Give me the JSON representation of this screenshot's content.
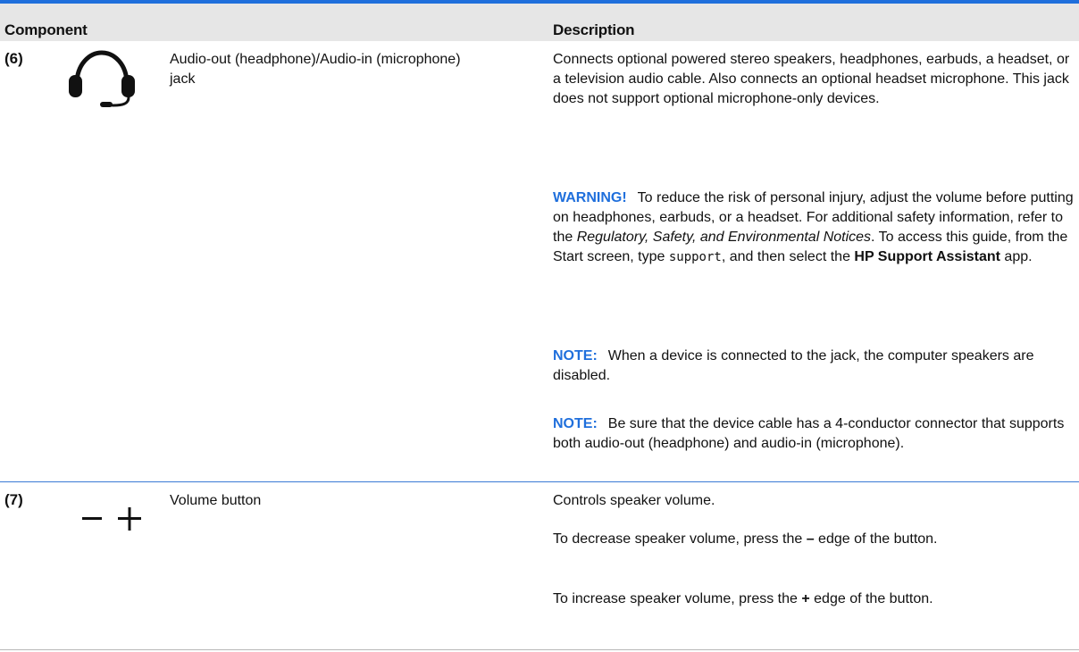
{
  "header": {
    "component": "Component",
    "description": "Description"
  },
  "rows": [
    {
      "number": "(6)",
      "icon": "headphone-icon",
      "name": "Audio-out (headphone)/Audio-in (microphone) jack",
      "main": "Connects optional powered stereo speakers, headphones, earbuds, a headset, or a television audio cable. Also connects an optional headset microphone. This jack does not support optional microphone-only devices.",
      "warning": {
        "label": "WARNING!",
        "text1": "To reduce the risk of personal injury, adjust the volume before putting on headphones, earbuds, or a headset. For additional safety information, refer to the ",
        "italic": "Regulatory, Safety, and Environmental Notices",
        "text2": ". To access this guide, from the Start screen, type ",
        "code": "support",
        "text3": ", and then select the ",
        "bold": "HP Support Assistant",
        "text4": " app."
      },
      "note1": {
        "label": "NOTE:",
        "text": "When a device is connected to the jack, the computer speakers are disabled."
      },
      "note2": {
        "label": "NOTE:",
        "text": "Be sure that the device cable has a 4-conductor connector that supports both audio-out (headphone) and audio-in (microphone)."
      }
    },
    {
      "number": "(7)",
      "icon": "volume-minus-plus-icon",
      "name": "Volume button",
      "main": "Controls speaker volume.",
      "decrease": {
        "text1": "To decrease speaker volume, press the ",
        "symbol": "–",
        "text2": " edge of the button."
      },
      "increase": {
        "text1": "To increase speaker volume, press the ",
        "symbol": "+",
        "text2": " edge of the button."
      }
    }
  ],
  "colors": {
    "accent": "#1f6fdc",
    "header_bg": "#e6e6e6",
    "text": "#111111"
  }
}
